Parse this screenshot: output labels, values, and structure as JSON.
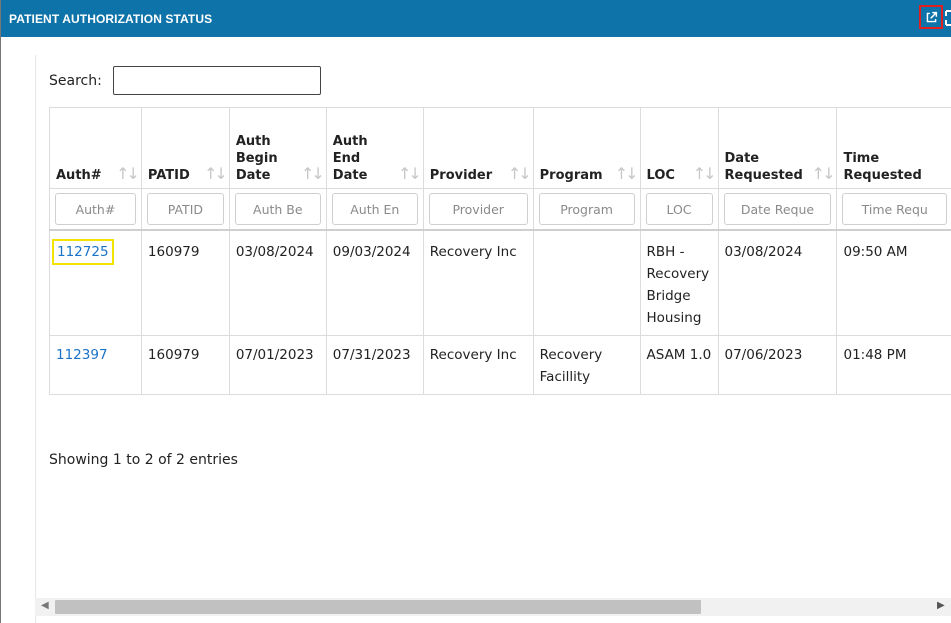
{
  "window": {
    "title": "PATIENT AUTHORIZATION STATUS"
  },
  "search": {
    "label": "Search:",
    "value": ""
  },
  "columns": [
    {
      "label": "Auth#",
      "placeholder": "Auth#"
    },
    {
      "label": "PATID",
      "placeholder": "PATID"
    },
    {
      "label": "Auth Begin Date",
      "placeholder": "Auth Be"
    },
    {
      "label": "Auth End Date",
      "placeholder": "Auth En"
    },
    {
      "label": "Provider",
      "placeholder": "Provider"
    },
    {
      "label": "Program",
      "placeholder": "Program"
    },
    {
      "label": "LOC",
      "placeholder": "LOC"
    },
    {
      "label": "Date Requested",
      "placeholder": "Date Reque"
    },
    {
      "label": "Time Requested",
      "placeholder": "Time Requ"
    }
  ],
  "rows": [
    {
      "auth": "112725",
      "patid": "160979",
      "begin": "03/08/2024",
      "end": "09/03/2024",
      "provider": "Recovery Inc",
      "program": "",
      "loc": "RBH - Recovery Bridge Housing",
      "date_requested": "03/08/2024",
      "time_requested": "09:50 AM"
    },
    {
      "auth": "112397",
      "patid": "160979",
      "begin": "07/01/2023",
      "end": "07/31/2023",
      "provider": "Recovery Inc",
      "program": "Recovery Facillity",
      "loc": "ASAM 1.0",
      "date_requested": "07/06/2023",
      "time_requested": "01:48 PM"
    }
  ],
  "footer": {
    "info": "Showing 1 to 2 of 2 entries"
  },
  "icons": {
    "popout": "external-link-icon",
    "expand": "expand-icon",
    "sort": "sort-arrows-icon"
  },
  "colors": {
    "titlebar": "#0d73a8",
    "link": "#1a73c9",
    "highlight": "#f2e300",
    "popout_border": "#e02020"
  }
}
